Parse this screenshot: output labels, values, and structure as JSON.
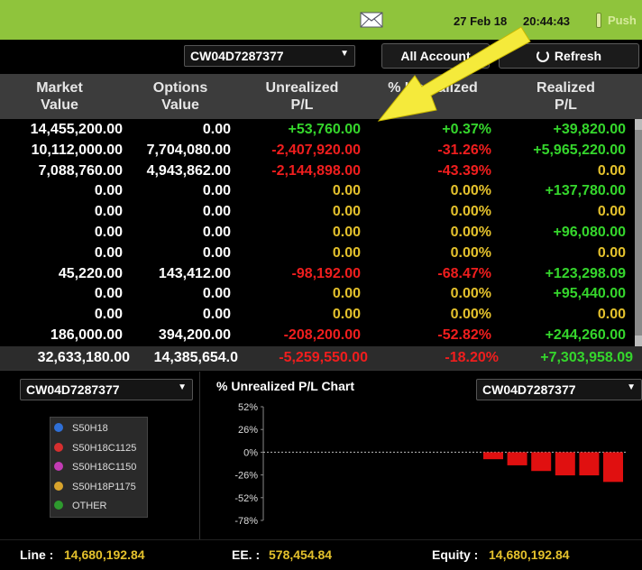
{
  "topbar": {
    "date": "27 Feb 18",
    "time": "20:44:43",
    "push_label": "Push",
    "mail_icon": "mail-icon"
  },
  "toolbar": {
    "account_select": "CW04D7287377",
    "all_account_label": "All Account",
    "refresh_label": "Refresh"
  },
  "table": {
    "headers": [
      [
        "Market",
        "Value"
      ],
      [
        "Options",
        "Value"
      ],
      [
        "Unrealized",
        "P/L"
      ],
      [
        "% Unrealized",
        ""
      ],
      [
        "Realized",
        "P/L"
      ]
    ],
    "rows": [
      [
        "14,455,200.00",
        "0.00",
        "+53,760.00",
        "+0.37%",
        "+39,820.00"
      ],
      [
        "10,112,000.00",
        "7,704,080.00",
        "-2,407,920.00",
        "-31.26%",
        "+5,965,220.00"
      ],
      [
        "7,088,760.00",
        "4,943,862.00",
        "-2,144,898.00",
        "-43.39%",
        "0.00"
      ],
      [
        "0.00",
        "0.00",
        "0.00",
        "0.00%",
        "+137,780.00"
      ],
      [
        "0.00",
        "0.00",
        "0.00",
        "0.00%",
        "0.00"
      ],
      [
        "0.00",
        "0.00",
        "0.00",
        "0.00%",
        "+96,080.00"
      ],
      [
        "0.00",
        "0.00",
        "0.00",
        "0.00%",
        "0.00"
      ],
      [
        "45,220.00",
        "143,412.00",
        "-98,192.00",
        "-68.47%",
        "+123,298.09"
      ],
      [
        "0.00",
        "0.00",
        "0.00",
        "0.00%",
        "+95,440.00"
      ],
      [
        "0.00",
        "0.00",
        "0.00",
        "0.00%",
        "0.00"
      ],
      [
        "186,000.00",
        "394,200.00",
        "-208,200.00",
        "-52.82%",
        "+244,260.00"
      ]
    ],
    "total": [
      "32,633,180.00",
      "14,385,654.0",
      "-5,259,550.00",
      "-18.20%",
      "+7,303,958.09"
    ]
  },
  "left_panel": {
    "account_select": "CW04D7287377",
    "legend": [
      {
        "label": "S50H18",
        "color": "#2f6fd6"
      },
      {
        "label": "S50H18C1125",
        "color": "#d62f2f"
      },
      {
        "label": "S50H18C1150",
        "color": "#c23bb4"
      },
      {
        "label": "S50H18P1175",
        "color": "#d8a32c"
      },
      {
        "label": "OTHER",
        "color": "#2e9a2e"
      }
    ]
  },
  "chart_panel": {
    "title": "% Unrealized P/L Chart",
    "account_select": "CW04D7287377"
  },
  "chart_data": {
    "type": "bar",
    "title": "% Unrealized P/L Chart",
    "yticks": [
      "52%",
      "26%",
      "0%",
      "-26%",
      "-52%",
      "-78%"
    ],
    "ylim": [
      -78,
      52
    ],
    "bar_color": "#e01010",
    "values": [
      -8,
      -15,
      -21.5,
      -26.5,
      -26.5,
      -34
    ]
  },
  "status": {
    "line_label": "Line :",
    "line_value": "14,680,192.84",
    "ee_label": "EE. :",
    "ee_value": "578,454.84",
    "equity_label": "Equity :",
    "equity_value": "14,680,192.84"
  }
}
